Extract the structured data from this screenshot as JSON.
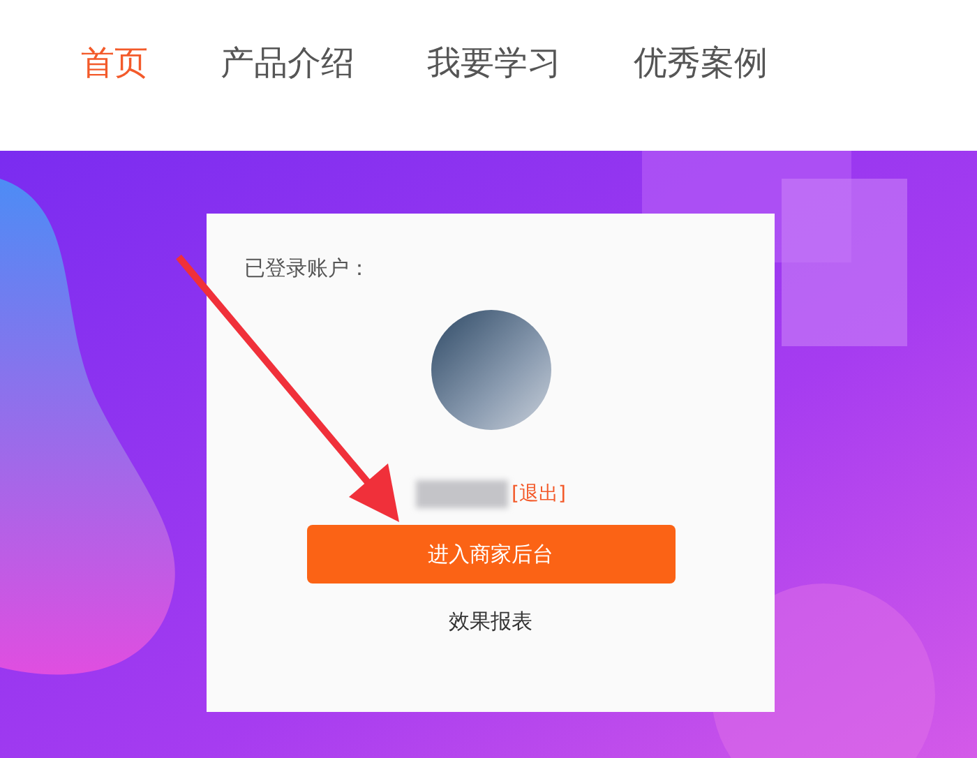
{
  "nav": [
    {
      "label": "首页",
      "selected": true
    },
    {
      "label": "产品介绍",
      "selected": false
    },
    {
      "label": "我要学习",
      "selected": false
    },
    {
      "label": "优秀案例",
      "selected": false
    }
  ],
  "login_card": {
    "label": "已登录账户：",
    "logout": "[退出]",
    "button": "进入商家后台",
    "link": "效果报表"
  }
}
